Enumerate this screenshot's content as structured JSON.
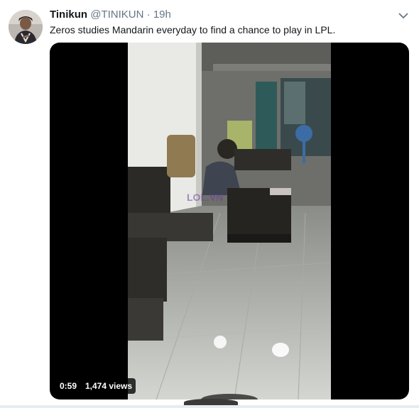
{
  "tweet": {
    "author_name": "Tinikun",
    "author_handle": "@TINIKUN",
    "separator": "·",
    "time": "19h",
    "text": "Zeros studies Mandarin everyday to find a chance to play in LPL.",
    "video": {
      "duration": "0:59",
      "views": "1,474 views",
      "watermark_text": "LOL.VN"
    }
  },
  "icons": {
    "menu": "chevron-down-icon",
    "avatar": "avatar-image"
  },
  "colors": {
    "name": "#14171a",
    "secondary": "#657786",
    "media_bg": "#000000"
  }
}
